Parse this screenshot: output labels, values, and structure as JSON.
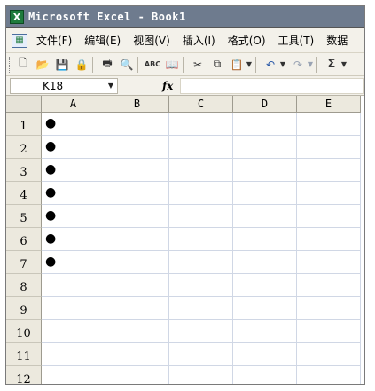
{
  "window": {
    "app_icon": "excel-icon",
    "title": "Microsoft Excel - Book1"
  },
  "menu": {
    "doc_icon": "workbook-icon",
    "items": [
      "文件(F)",
      "编辑(E)",
      "视图(V)",
      "插入(I)",
      "格式(O)",
      "工具(T)",
      "数据"
    ]
  },
  "toolbar": {
    "buttons": [
      {
        "name": "new-icon",
        "glyph": "🗋"
      },
      {
        "name": "open-icon",
        "glyph": "📂"
      },
      {
        "name": "save-icon",
        "glyph": "💾"
      },
      {
        "name": "permission-icon",
        "glyph": "🔒"
      },
      {
        "name": "print-icon",
        "glyph": "🖶"
      },
      {
        "name": "print-preview-icon",
        "glyph": "🔍"
      },
      {
        "name": "spelling-icon",
        "glyph": "ABC"
      },
      {
        "name": "research-icon",
        "glyph": "📖"
      },
      {
        "name": "cut-icon",
        "glyph": "✂"
      },
      {
        "name": "copy-icon",
        "glyph": "⧉"
      },
      {
        "name": "paste-icon",
        "glyph": "📋"
      },
      {
        "name": "undo-icon",
        "glyph": "↶"
      },
      {
        "name": "redo-icon",
        "glyph": "↷"
      },
      {
        "name": "autosum-icon",
        "glyph": "Σ"
      }
    ]
  },
  "formula_bar": {
    "name_box": "K18",
    "fx_label": "fx",
    "formula": ""
  },
  "sheet": {
    "columns": [
      "A",
      "B",
      "C",
      "D",
      "E"
    ],
    "rows": [
      {
        "label": "1",
        "a": "●"
      },
      {
        "label": "2",
        "a": "●"
      },
      {
        "label": "3",
        "a": "●"
      },
      {
        "label": "4",
        "a": "●"
      },
      {
        "label": "5",
        "a": "●"
      },
      {
        "label": "6",
        "a": "●"
      },
      {
        "label": "7",
        "a": "●"
      },
      {
        "label": "8",
        "a": ""
      },
      {
        "label": "9",
        "a": ""
      },
      {
        "label": "10",
        "a": ""
      },
      {
        "label": "11",
        "a": ""
      },
      {
        "label": "12",
        "a": ""
      }
    ]
  }
}
